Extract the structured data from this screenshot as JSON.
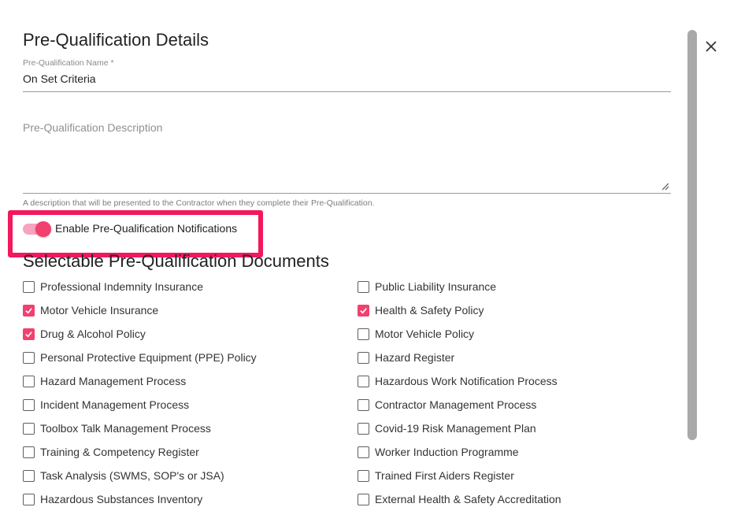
{
  "dialog": {
    "title": "Pre-Qualification Details",
    "close_icon": "close-icon"
  },
  "form": {
    "name_label": "Pre-Qualification Name *",
    "name_value": "On Set Criteria",
    "description_placeholder": "Pre-Qualification Description",
    "description_value": "",
    "description_helper": "A description that will be presented to the Contractor when they complete their Pre-Qualification.",
    "notifications_label": "Enable Pre-Qualification Notifications",
    "notifications_enabled": true
  },
  "documents": {
    "section_title": "Selectable Pre-Qualification Documents",
    "left": [
      {
        "label": "Professional Indemnity Insurance",
        "checked": false
      },
      {
        "label": "Motor Vehicle Insurance",
        "checked": true
      },
      {
        "label": "Drug & Alcohol Policy",
        "checked": true
      },
      {
        "label": "Personal Protective Equipment (PPE) Policy",
        "checked": false
      },
      {
        "label": "Hazard Management Process",
        "checked": false
      },
      {
        "label": "Incident Management Process",
        "checked": false
      },
      {
        "label": "Toolbox Talk Management Process",
        "checked": false
      },
      {
        "label": "Training & Competency Register",
        "checked": false
      },
      {
        "label": "Task Analysis (SWMS, SOP's or JSA)",
        "checked": false
      },
      {
        "label": "Hazardous Substances Inventory",
        "checked": false
      }
    ],
    "right": [
      {
        "label": "Public Liability Insurance",
        "checked": false
      },
      {
        "label": "Health & Safety Policy",
        "checked": true
      },
      {
        "label": "Motor Vehicle Policy",
        "checked": false
      },
      {
        "label": "Hazard Register",
        "checked": false
      },
      {
        "label": "Hazardous Work Notification Process",
        "checked": false
      },
      {
        "label": "Contractor Management Process",
        "checked": false
      },
      {
        "label": "Covid-19 Risk Management Plan",
        "checked": false
      },
      {
        "label": "Worker Induction Programme",
        "checked": false
      },
      {
        "label": "Trained First Aiders Register",
        "checked": false
      },
      {
        "label": "External Health & Safety Accreditation",
        "checked": false
      }
    ]
  },
  "colors": {
    "accent": "#f2406f",
    "highlight": "#f2185d"
  }
}
